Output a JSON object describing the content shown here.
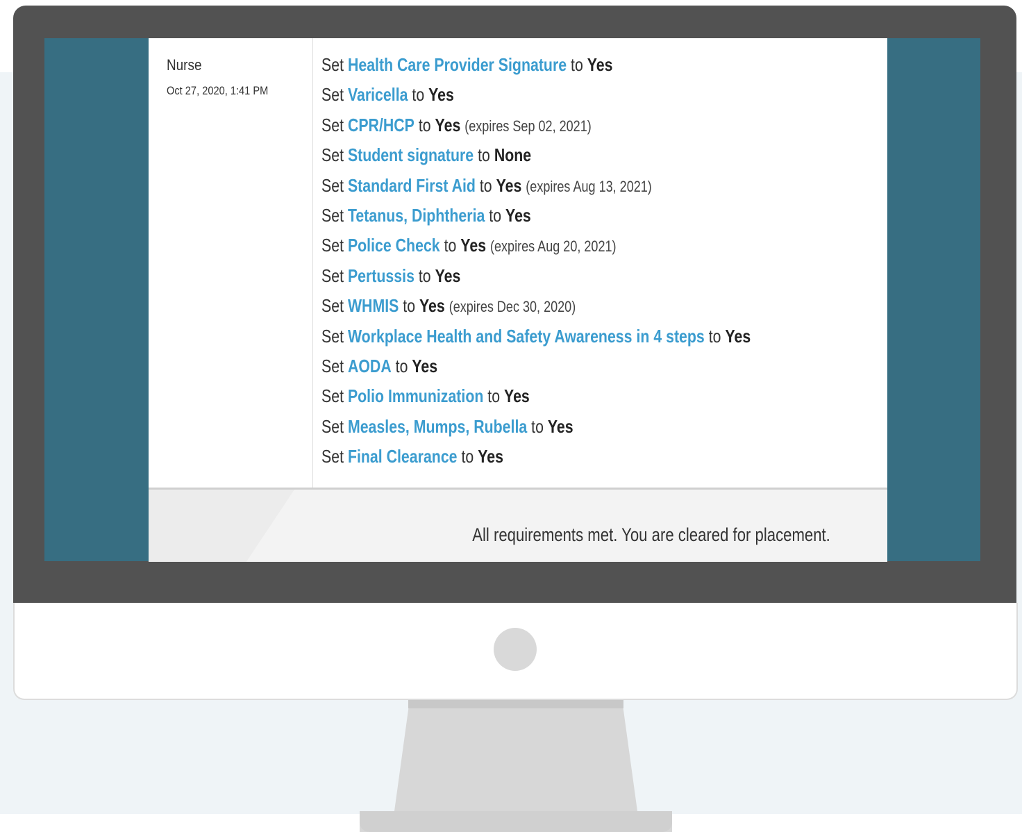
{
  "entry": {
    "author": "Nurse",
    "timestamp": "Oct 27, 2020, 1:41 PM",
    "changes": [
      {
        "verb": "Set",
        "field": "Health Care Provider Signature",
        "to": "to",
        "value": "Yes",
        "expires": ""
      },
      {
        "verb": "Set",
        "field": "Varicella",
        "to": "to",
        "value": "Yes",
        "expires": ""
      },
      {
        "verb": "Set",
        "field": "CPR/HCP",
        "to": "to",
        "value": "Yes",
        "expires": "(expires Sep 02, 2021)"
      },
      {
        "verb": "Set",
        "field": "Student signature",
        "to": "to",
        "value": "None",
        "expires": ""
      },
      {
        "verb": "Set",
        "field": "Standard First Aid",
        "to": "to",
        "value": "Yes",
        "expires": "(expires Aug 13, 2021)"
      },
      {
        "verb": "Set",
        "field": "Tetanus, Diphtheria",
        "to": "to",
        "value": "Yes",
        "expires": ""
      },
      {
        "verb": "Set",
        "field": "Police Check",
        "to": "to",
        "value": "Yes",
        "expires": "(expires Aug 20, 2021)"
      },
      {
        "verb": "Set",
        "field": "Pertussis",
        "to": "to",
        "value": "Yes",
        "expires": ""
      },
      {
        "verb": "Set",
        "field": "WHMIS",
        "to": "to",
        "value": "Yes",
        "expires": "(expires Dec 30, 2020)"
      },
      {
        "verb": "Set",
        "field": "Workplace Health and Safety Awareness in 4 steps",
        "to": "to",
        "value": "Yes",
        "expires": ""
      },
      {
        "verb": "Set",
        "field": "AODA",
        "to": "to",
        "value": "Yes",
        "expires": ""
      },
      {
        "verb": "Set",
        "field": "Polio Immunization",
        "to": "to",
        "value": "Yes",
        "expires": ""
      },
      {
        "verb": "Set",
        "field": "Measles, Mumps, Rubella",
        "to": "to",
        "value": "Yes",
        "expires": ""
      },
      {
        "verb": "Set",
        "field": "Final Clearance",
        "to": "to",
        "value": "Yes",
        "expires": ""
      }
    ]
  },
  "footer": {
    "status": "All requirements met. You are cleared for placement."
  },
  "colors": {
    "screen_background": "#376e82",
    "link": "#3b9ccf",
    "bezel": "#525252"
  }
}
